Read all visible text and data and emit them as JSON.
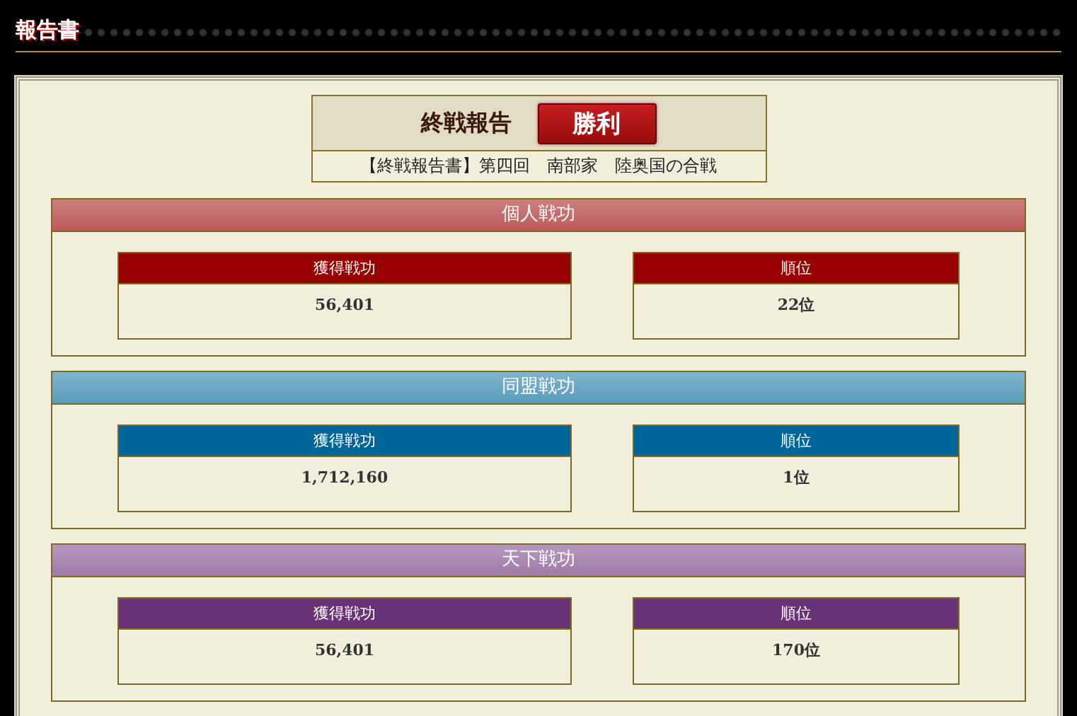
{
  "page_title": "報告書",
  "report": {
    "heading": "終戦報告",
    "result": "勝利",
    "subtitle": "【終戦報告書】第四回　南部家　陸奥国の合戦"
  },
  "sections": [
    {
      "title": "個人戦功",
      "color": "#990000",
      "cells": [
        {
          "label": "獲得戦功",
          "value": "56,401"
        },
        {
          "label": "順位",
          "value": "22位"
        }
      ]
    },
    {
      "title": "同盟戦功",
      "color": "#006699",
      "cells": [
        {
          "label": "獲得戦功",
          "value": "1,712,160"
        },
        {
          "label": "順位",
          "value": "1位"
        }
      ]
    },
    {
      "title": "天下戦功",
      "color": "#6a3378",
      "cells": [
        {
          "label": "獲得戦功",
          "value": "56,401"
        },
        {
          "label": "順位",
          "value": "170位"
        }
      ]
    }
  ]
}
